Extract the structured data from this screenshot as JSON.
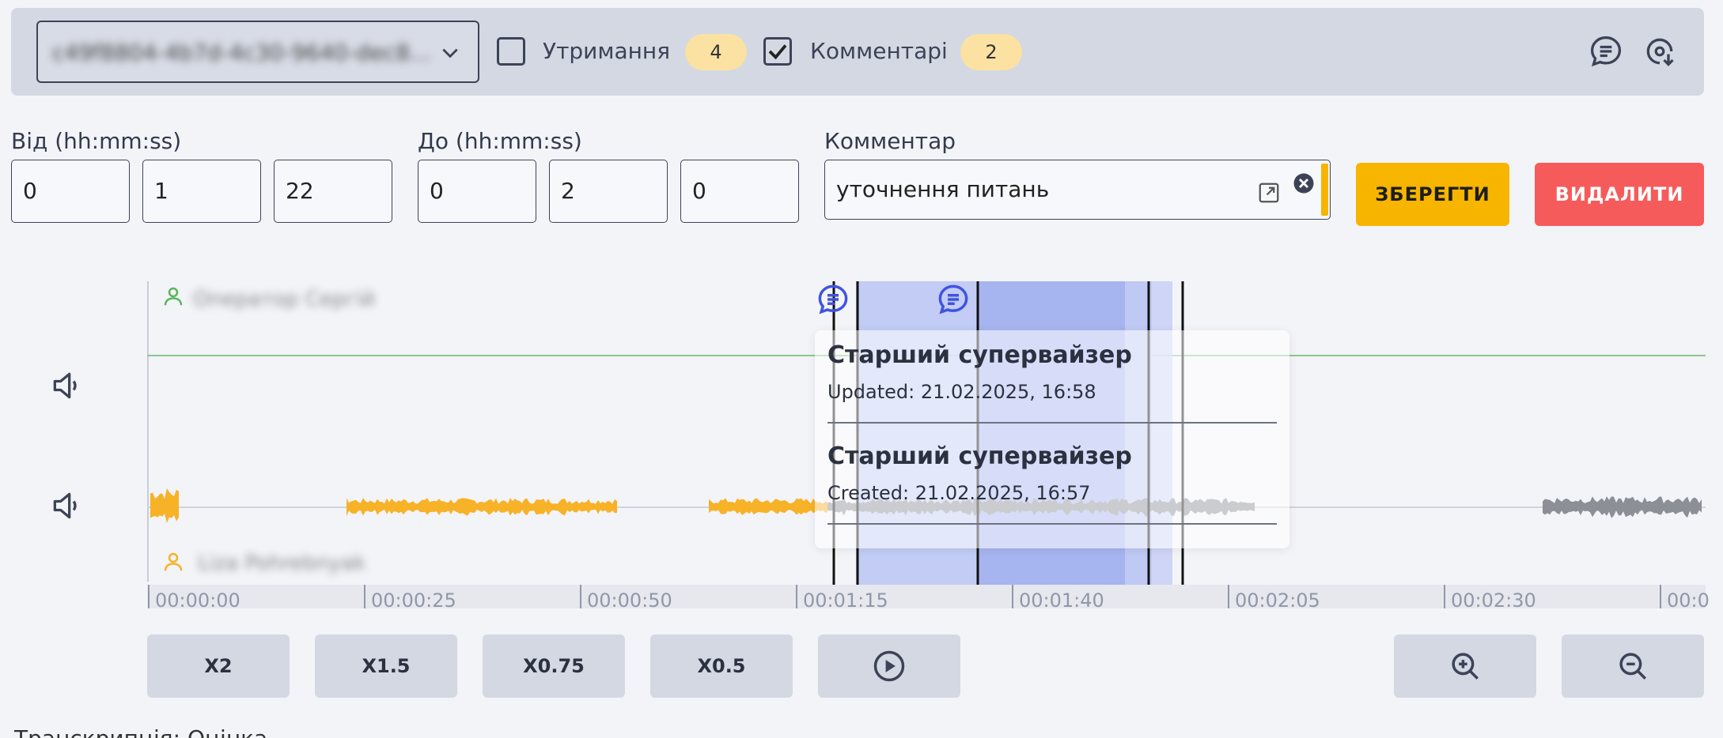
{
  "toolbar": {
    "record_select_value": "c49f8804-4b7d-4c30-9640-dec8...",
    "holds_label": "Утримання",
    "holds_count": "4",
    "holds_checked": false,
    "comments_label": "Комментарі",
    "comments_count": "2",
    "comments_checked": true
  },
  "form": {
    "from_label": "Від (hh:mm:ss)",
    "from_h": "0",
    "from_m": "1",
    "from_s": "22",
    "to_label": "До (hh:mm:ss)",
    "to_h": "0",
    "to_m": "2",
    "to_s": "0",
    "comment_label": "Комментар",
    "comment_value": "уточнення питань",
    "save_label": "ЗБЕРЕГТИ",
    "delete_label": "ВИДАЛИТИ"
  },
  "tracks": {
    "top_speaker": "Оператор Сергій",
    "bottom_speaker": "Liza Pohrebnyak"
  },
  "popup": {
    "item1_title": "Старший супервайзер",
    "item1_date": "Updated: 21.02.2025, 16:58",
    "item2_title": "Старший супервайзер",
    "item2_date": "Created: 21.02.2025, 16:57"
  },
  "timeline": {
    "ticks": [
      "00:00:00",
      "00:00:25",
      "00:00:50",
      "00:01:15",
      "00:01:40",
      "00:02:05",
      "00:02:30",
      "00:0"
    ]
  },
  "controls": {
    "speed_2": "X2",
    "speed_15": "X1.5",
    "speed_075": "X0.75",
    "speed_05": "X0.5"
  },
  "footer": {
    "text": "Транскрипція: Оцінка"
  },
  "colors": {
    "accent_yellow": "#f7b500",
    "danger_red": "#f65b5b",
    "region_blue": "#a6b4f0",
    "wave_orange": "#f7b228",
    "track_green": "#8cc98c"
  }
}
